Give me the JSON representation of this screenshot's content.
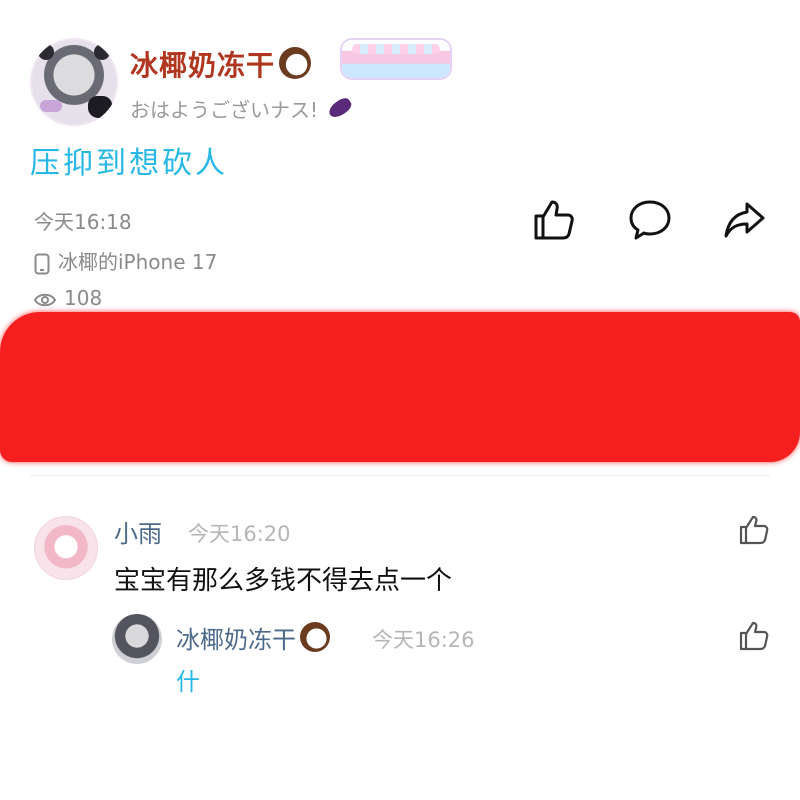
{
  "post": {
    "author": {
      "name": "冰椰奶冻干",
      "greeting": "おはようございナス!"
    },
    "content": "压抑到想砍人",
    "time": "今天16:18",
    "device": "冰椰的iPhone 17",
    "views": "108"
  },
  "comments": [
    {
      "author": "小雨",
      "time": "今天16:20",
      "text": "宝宝有那么多钱不得去点一个",
      "replies": [
        {
          "author": "冰椰奶冻干",
          "time": "今天16:26",
          "text": "什"
        }
      ]
    }
  ],
  "colors": {
    "username": "#b0361f",
    "accent_blue": "#27b8e6",
    "comment_name": "#4d6a8c",
    "meta_gray": "#8a8a8a",
    "redaction": "#f51f1f"
  },
  "icons": [
    "coconut-icon",
    "eggplant-icon",
    "like-icon",
    "comment-icon",
    "share-icon",
    "phone-icon",
    "eye-icon"
  ]
}
